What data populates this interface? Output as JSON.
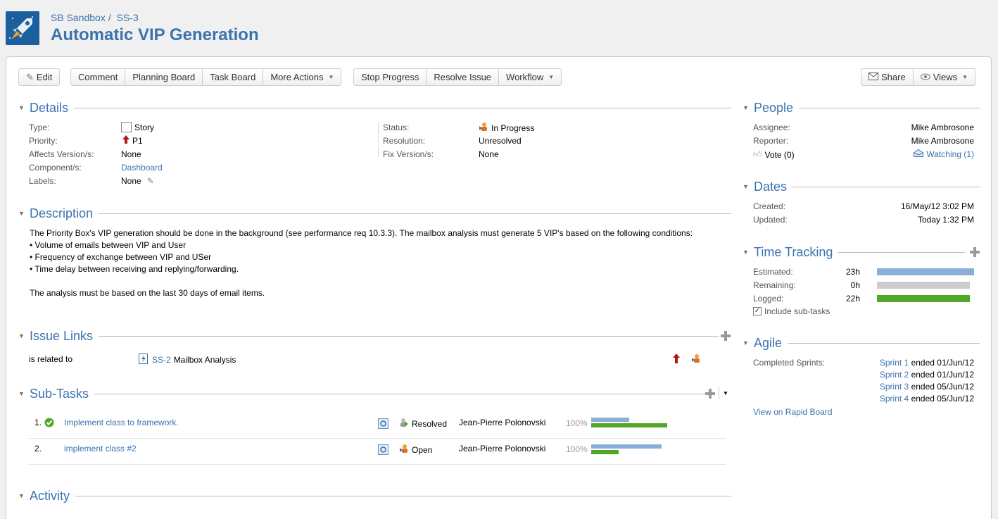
{
  "breadcrumb": {
    "project": "SB Sandbox",
    "separator": "/",
    "issue_key": "SS-3"
  },
  "title": "Automatic VIP Generation",
  "toolbar": {
    "edit": "Edit",
    "comment": "Comment",
    "planning_board": "Planning Board",
    "task_board": "Task Board",
    "more_actions": "More Actions",
    "stop_progress": "Stop Progress",
    "resolve_issue": "Resolve Issue",
    "workflow": "Workflow",
    "share": "Share",
    "views": "Views"
  },
  "details": {
    "heading": "Details",
    "type_label": "Type:",
    "type_value": "Story",
    "priority_label": "Priority:",
    "priority_value": "P1",
    "affects_label": "Affects Version/s:",
    "affects_value": "None",
    "component_label": "Component/s:",
    "component_value": "Dashboard",
    "labels_label": "Labels:",
    "labels_value": "None",
    "status_label": "Status:",
    "status_value": "In Progress",
    "resolution_label": "Resolution:",
    "resolution_value": "Unresolved",
    "fix_label": "Fix Version/s:",
    "fix_value": "None"
  },
  "description": {
    "heading": "Description",
    "line1": "The Priority Box's VIP generation should be done in the background (see performance req 10.3.3). The mailbox analysis must generate 5 VIP's based on the following conditions:",
    "bullet1": "• Volume of emails between VIP and User",
    "bullet2": "• Frequency of exchange between VIP and USer",
    "bullet3": "• Time delay between receiving and replying/forwarding.",
    "line2": "The analysis must be based on the last 30 days of email items."
  },
  "issue_links": {
    "heading": "Issue Links",
    "relation": "is related to",
    "key": "SS-2",
    "summary": "Mailbox Analysis"
  },
  "subtasks": {
    "heading": "Sub-Tasks",
    "rows": [
      {
        "num": "1.",
        "summary": "Implement class to framework.",
        "status": "Resolved",
        "assignee": "Jean-Pierre Polonovski",
        "progress": "100%",
        "estimate_fraction": 0.5,
        "logged_fraction": 1.0
      },
      {
        "num": "2.",
        "summary": "implement class #2",
        "status": "Open",
        "assignee": "Jean-Pierre Polonovski",
        "progress": "100%",
        "estimate_fraction": 0.93,
        "logged_fraction": 0.36
      }
    ]
  },
  "activity": {
    "heading": "Activity"
  },
  "people": {
    "heading": "People",
    "assignee_label": "Assignee:",
    "assignee_value": "Mike Ambrosone",
    "reporter_label": "Reporter:",
    "reporter_value": "Mike Ambrosone",
    "vote": "Vote (0)",
    "watching": "Watching (1)"
  },
  "dates": {
    "heading": "Dates",
    "created_label": "Created:",
    "created_value": "16/May/12 3:02 PM",
    "updated_label": "Updated:",
    "updated_value": "Today 1:32 PM"
  },
  "time_tracking": {
    "heading": "Time Tracking",
    "estimated_label": "Estimated:",
    "estimated_value": "23h",
    "remaining_label": "Remaining:",
    "remaining_value": "0h",
    "logged_label": "Logged:",
    "logged_value": "22h",
    "include_subtasks": "Include sub-tasks",
    "colors": {
      "estimated": "#89afd7",
      "remaining": "#cccccc",
      "logged": "#51a825"
    }
  },
  "agile": {
    "heading": "Agile",
    "completed_label": "Completed Sprints:",
    "sprints": [
      {
        "name": "Sprint 1",
        "ended": "ended 01/Jun/12"
      },
      {
        "name": "Sprint 2",
        "ended": "ended 01/Jun/12"
      },
      {
        "name": "Sprint 3",
        "ended": "ended 05/Jun/12"
      },
      {
        "name": "Sprint 4",
        "ended": "ended 05/Jun/12"
      }
    ],
    "rapid_board": "View on Rapid Board"
  }
}
